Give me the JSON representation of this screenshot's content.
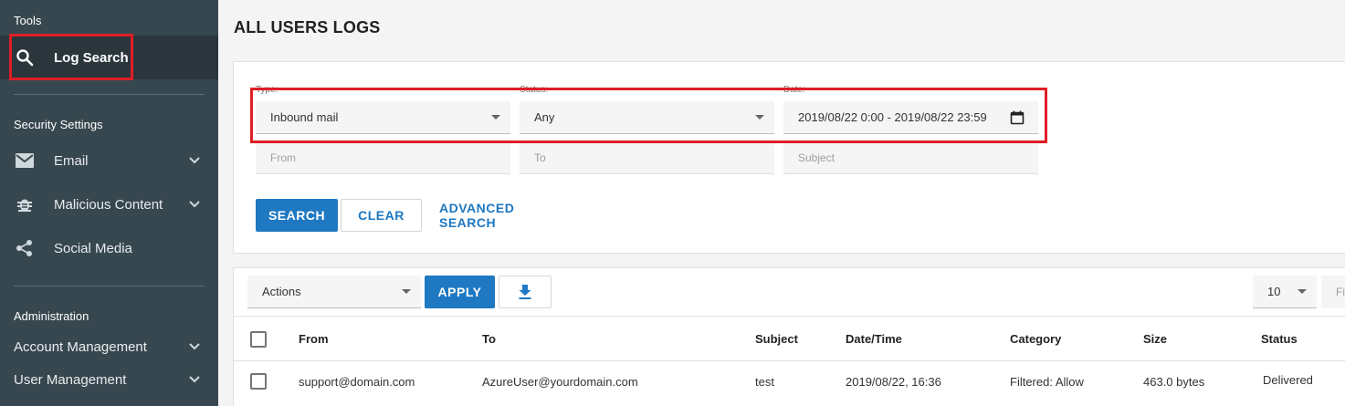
{
  "sidebar": {
    "tools_heading": "Tools",
    "log_search_label": "Log Search",
    "security_heading": "Security Settings",
    "email_label": "Email",
    "malicious_label": "Malicious Content",
    "social_label": "Social Media",
    "admin_heading": "Administration",
    "account_mgmt_label": "Account Management",
    "user_mgmt_label": "User Management"
  },
  "page": {
    "title": "ALL USERS LOGS"
  },
  "filters": {
    "type_label": "Type:",
    "type_value": "Inbound mail",
    "status_label": "Status:",
    "status_value": "Any",
    "date_label": "Date:",
    "date_value": "2019/08/22 0:00 - 2019/08/22 23:59",
    "from_placeholder": "From",
    "to_placeholder": "To",
    "subject_placeholder": "Subject"
  },
  "buttons": {
    "search": "SEARCH",
    "clear": "CLEAR",
    "advanced": "ADVANCED SEARCH",
    "apply": "APPLY"
  },
  "toolbar": {
    "actions_value": "Actions",
    "page_size": "10",
    "filter_placeholder": "Fi"
  },
  "table": {
    "headers": [
      "From",
      "To",
      "Subject",
      "Date/Time",
      "Category",
      "Size",
      "Status"
    ],
    "rows": [
      {
        "from": "support@domain.com",
        "to": "AzureUser@yourdomain.com",
        "subject": "test",
        "datetime": "2019/08/22, 16:36",
        "category": "Filtered: Allow",
        "size": "463.0 bytes",
        "status": "Delivered"
      }
    ]
  },
  "colors": {
    "accent": "#1e78c2",
    "sidebar": "#37474f",
    "highlight": "#e01e25"
  }
}
